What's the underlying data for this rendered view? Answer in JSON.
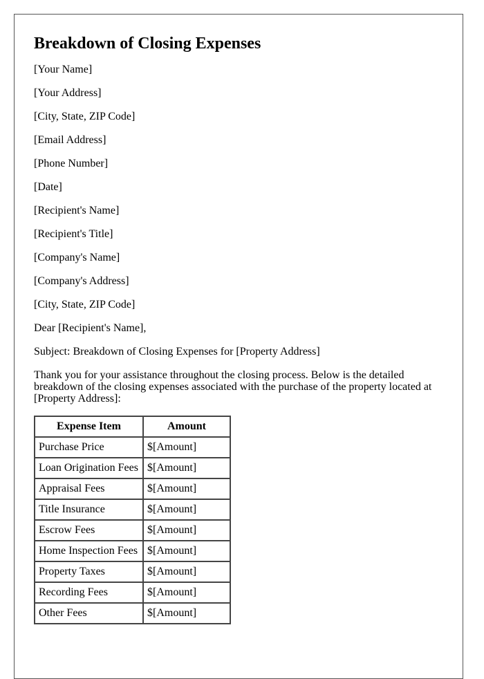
{
  "title": "Breakdown of Closing Expenses",
  "sender": {
    "name": "[Your Name]",
    "address": "[Your Address]",
    "city_state_zip": "[City, State, ZIP Code]",
    "email": "[Email Address]",
    "phone": "[Phone Number]",
    "date": "[Date]"
  },
  "recipient": {
    "name": "[Recipient's Name]",
    "title": "[Recipient's Title]",
    "company": "[Company's Name]",
    "company_address": "[Company's Address]",
    "city_state_zip": "[City, State, ZIP Code]"
  },
  "salutation": "Dear [Recipient's Name],",
  "subject": "Subject: Breakdown of Closing Expenses for [Property Address]",
  "intro": "Thank you for your assistance throughout the closing process. Below is the detailed breakdown of the closing expenses associated with the purchase of the property located at [Property Address]:",
  "table": {
    "headers": [
      "Expense Item",
      "Amount"
    ],
    "rows": [
      [
        "Purchase Price",
        "$[Amount]"
      ],
      [
        "Loan Origination Fees",
        "$[Amount]"
      ],
      [
        "Appraisal Fees",
        "$[Amount]"
      ],
      [
        "Title Insurance",
        "$[Amount]"
      ],
      [
        "Escrow Fees",
        "$[Amount]"
      ],
      [
        "Home Inspection Fees",
        "$[Amount]"
      ],
      [
        "Property Taxes",
        "$[Amount]"
      ],
      [
        "Recording Fees",
        "$[Amount]"
      ],
      [
        "Other Fees",
        "$[Amount]"
      ]
    ]
  }
}
